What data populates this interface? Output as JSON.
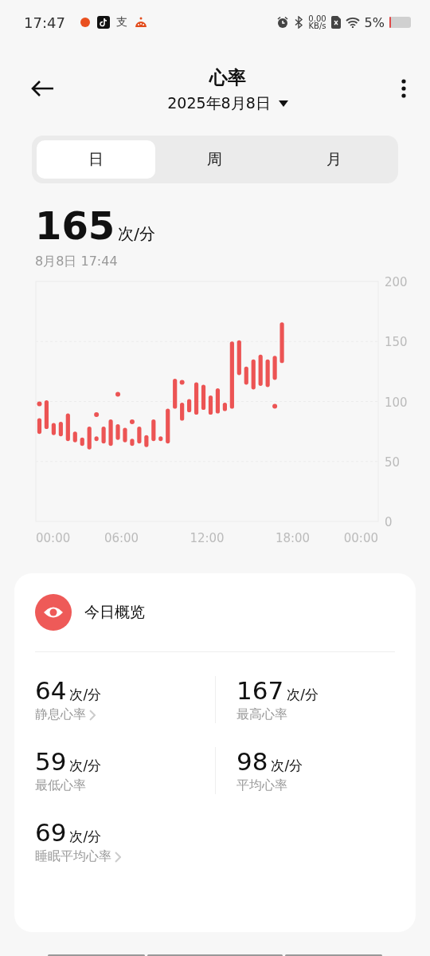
{
  "status_bar": {
    "time": "17:47",
    "notification_glyph": "支",
    "net_speed": "0.00",
    "net_unit": "KB/s",
    "battery": "5%"
  },
  "header": {
    "title": "心率",
    "date": "2025年8月8日"
  },
  "tabs": [
    {
      "label": "日",
      "selected": true
    },
    {
      "label": "周",
      "selected": false
    },
    {
      "label": "月",
      "selected": false
    }
  ],
  "summary": {
    "value": "165",
    "unit": "次/分",
    "time": "8月8日 17:44"
  },
  "chart_data": {
    "type": "candlestick",
    "x": [
      0.25,
      0.75,
      1.25,
      1.75,
      2.25,
      2.75,
      3.25,
      3.75,
      4.25,
      4.75,
      5.25,
      5.75,
      6.25,
      6.75,
      7.25,
      7.75,
      8.25,
      8.75,
      9.25,
      9.75,
      10.25,
      10.75,
      11.25,
      11.75,
      12.25,
      12.75,
      13.25,
      13.75,
      14.25,
      14.75,
      15.25,
      15.75,
      16.25,
      16.75,
      17.25
    ],
    "grid": true,
    "series": [
      {
        "type": "candlestick",
        "color": "#ec5454",
        "ohlc": [
          [
            73,
            86,
            73,
            86
          ],
          [
            77,
            101,
            77,
            101
          ],
          [
            72,
            82,
            72,
            82
          ],
          [
            71,
            83,
            71,
            83
          ],
          [
            67,
            90,
            67,
            90
          ],
          [
            66,
            75,
            66,
            75
          ],
          [
            63,
            70,
            63,
            70
          ],
          [
            60,
            79,
            60,
            79
          ],
          [
            67,
            71,
            67,
            71
          ],
          [
            65,
            79,
            65,
            79
          ],
          [
            63,
            85,
            63,
            85
          ],
          [
            68,
            81,
            68,
            81
          ],
          [
            66,
            78,
            66,
            78
          ],
          [
            63,
            69,
            63,
            69
          ],
          [
            65,
            79,
            65,
            79
          ],
          [
            62,
            72,
            62,
            72
          ],
          [
            67,
            85,
            67,
            85
          ],
          [
            67,
            71,
            67,
            71
          ],
          [
            65,
            94,
            65,
            94
          ],
          [
            94,
            119,
            94,
            119
          ],
          [
            84,
            99,
            84,
            99
          ],
          [
            91,
            102,
            91,
            102
          ],
          [
            89,
            116,
            89,
            116
          ],
          [
            93,
            114,
            93,
            114
          ],
          [
            89,
            105,
            89,
            105
          ],
          [
            90,
            111,
            90,
            111
          ],
          [
            92,
            99,
            92,
            99
          ],
          [
            94,
            150,
            94,
            150
          ],
          [
            122,
            151,
            122,
            151
          ],
          [
            114,
            129,
            114,
            129
          ],
          [
            110,
            135,
            110,
            135
          ],
          [
            113,
            139,
            113,
            139
          ],
          [
            112,
            135,
            112,
            135
          ],
          [
            118,
            138,
            118,
            138
          ],
          [
            132,
            166,
            132,
            166
          ]
        ]
      },
      {
        "type": "scatter",
        "color": "#ec5454",
        "values": [
          98,
          null,
          null,
          null,
          null,
          null,
          null,
          null,
          89,
          null,
          null,
          106,
          null,
          83,
          null,
          null,
          null,
          null,
          null,
          null,
          116,
          null,
          null,
          null,
          null,
          null,
          null,
          null,
          null,
          null,
          null,
          null,
          null,
          96,
          null
        ]
      }
    ],
    "xlim": [
      0,
      24
    ],
    "ylim": [
      0,
      200
    ],
    "xticks": [
      {
        "value": 0,
        "label": "00:00"
      },
      {
        "value": 6,
        "label": "06:00"
      },
      {
        "value": 12,
        "label": "12:00"
      },
      {
        "value": 18,
        "label": "18:00"
      },
      {
        "value": 24,
        "label": "00:00"
      }
    ],
    "yticks": [
      0,
      50,
      100,
      150,
      200
    ]
  },
  "overview": {
    "title": "今日概览",
    "stats": [
      {
        "value": "64",
        "unit": "次/分",
        "label": "静息心率",
        "has_detail": true
      },
      {
        "value": "167",
        "unit": "次/分",
        "label": "最高心率",
        "has_detail": false
      },
      {
        "value": "59",
        "unit": "次/分",
        "label": "最低心率",
        "has_detail": false
      },
      {
        "value": "98",
        "unit": "次/分",
        "label": "平均心率",
        "has_detail": false
      },
      {
        "value": "69",
        "unit": "次/分",
        "label": "睡眠平均心率",
        "has_detail": true
      }
    ]
  }
}
